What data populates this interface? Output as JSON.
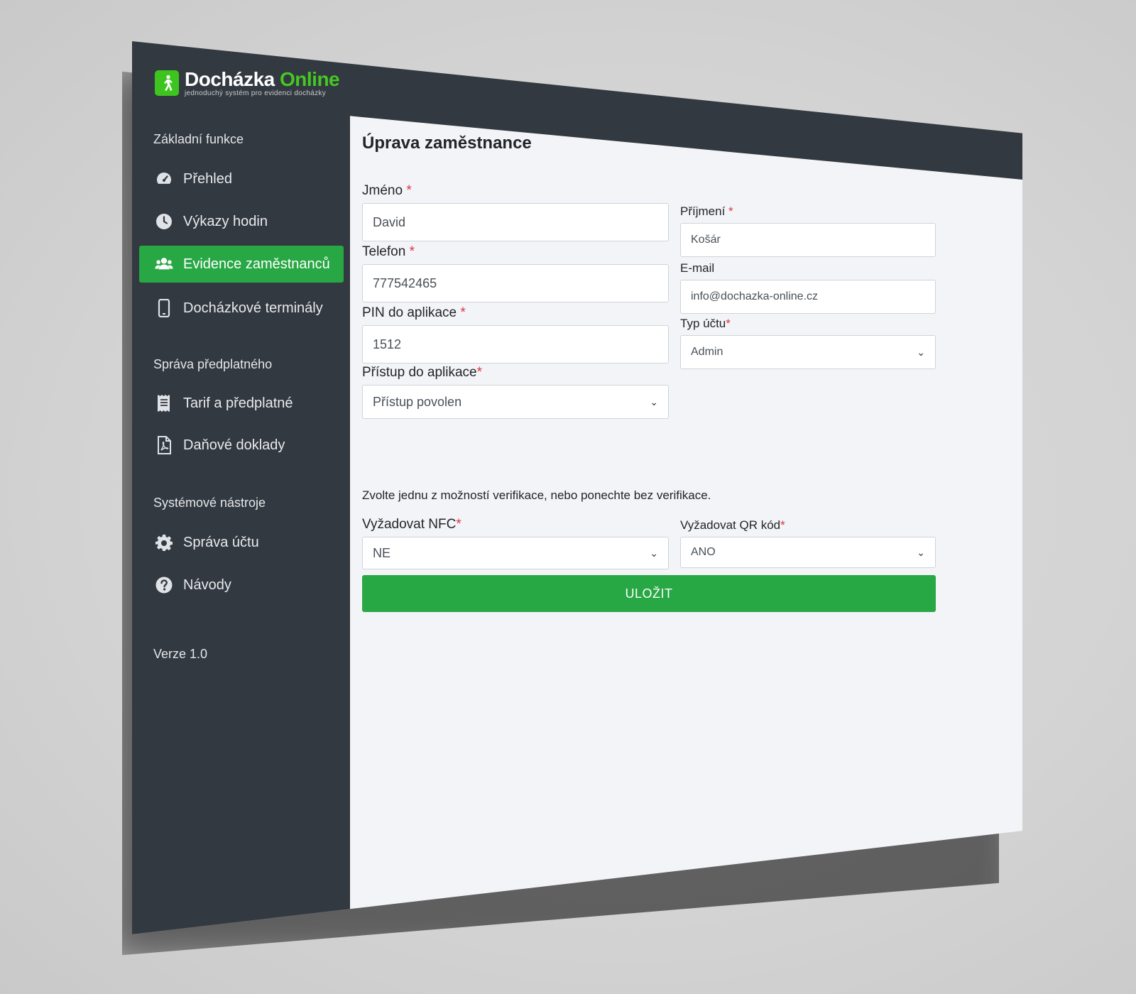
{
  "brand": {
    "name_part1": "Docházka",
    "name_part2": "Online",
    "tagline": "jednoduchý systém pro evidenci docházky",
    "accent": "#45c823"
  },
  "sidebar": {
    "sections": [
      {
        "label": "Základní funkce",
        "items": [
          {
            "label": "Přehled",
            "icon": "gauge-icon"
          },
          {
            "label": "Výkazy hodin",
            "icon": "clock-icon"
          },
          {
            "label": "Evidence zaměstnanců",
            "icon": "users-icon",
            "active": true
          },
          {
            "label": "Docházkové terminály",
            "icon": "phone-icon"
          }
        ]
      },
      {
        "label": "Správa předplatného",
        "items": [
          {
            "label": "Tarif a předplatné",
            "icon": "receipt-icon"
          },
          {
            "label": "Daňové doklady",
            "icon": "pdf-icon"
          }
        ]
      },
      {
        "label": "Systémové nástroje",
        "items": [
          {
            "label": "Správa účtu",
            "icon": "gear-icon"
          },
          {
            "label": "Návody",
            "icon": "question-icon"
          }
        ]
      }
    ],
    "version": "Verze 1.0"
  },
  "form": {
    "title": "Úprava zaměstnance",
    "first_name": {
      "label": "Jméno",
      "value": "David"
    },
    "last_name": {
      "label": "Příjmení",
      "value": "Košár"
    },
    "phone": {
      "label": "Telefon",
      "value": "777542465"
    },
    "email": {
      "label": "E-mail",
      "value": "info@dochazka-online.cz"
    },
    "pin": {
      "label": "PIN do aplikace",
      "value": "1512"
    },
    "account_type": {
      "label": "Typ účtu",
      "value": "Admin"
    },
    "access": {
      "label": "Přístup do aplikace",
      "value": "Přístup povolen"
    },
    "verification_help": "Zvolte jednu z možností verifikace, nebo ponechte bez verifikace.",
    "require_nfc": {
      "label": "Vyžadovat NFC",
      "value": "NE"
    },
    "require_qr": {
      "label": "Vyžadovat QR kód",
      "value": "ANO"
    },
    "required_mark": "*",
    "save_label": "ULOŽIT"
  }
}
